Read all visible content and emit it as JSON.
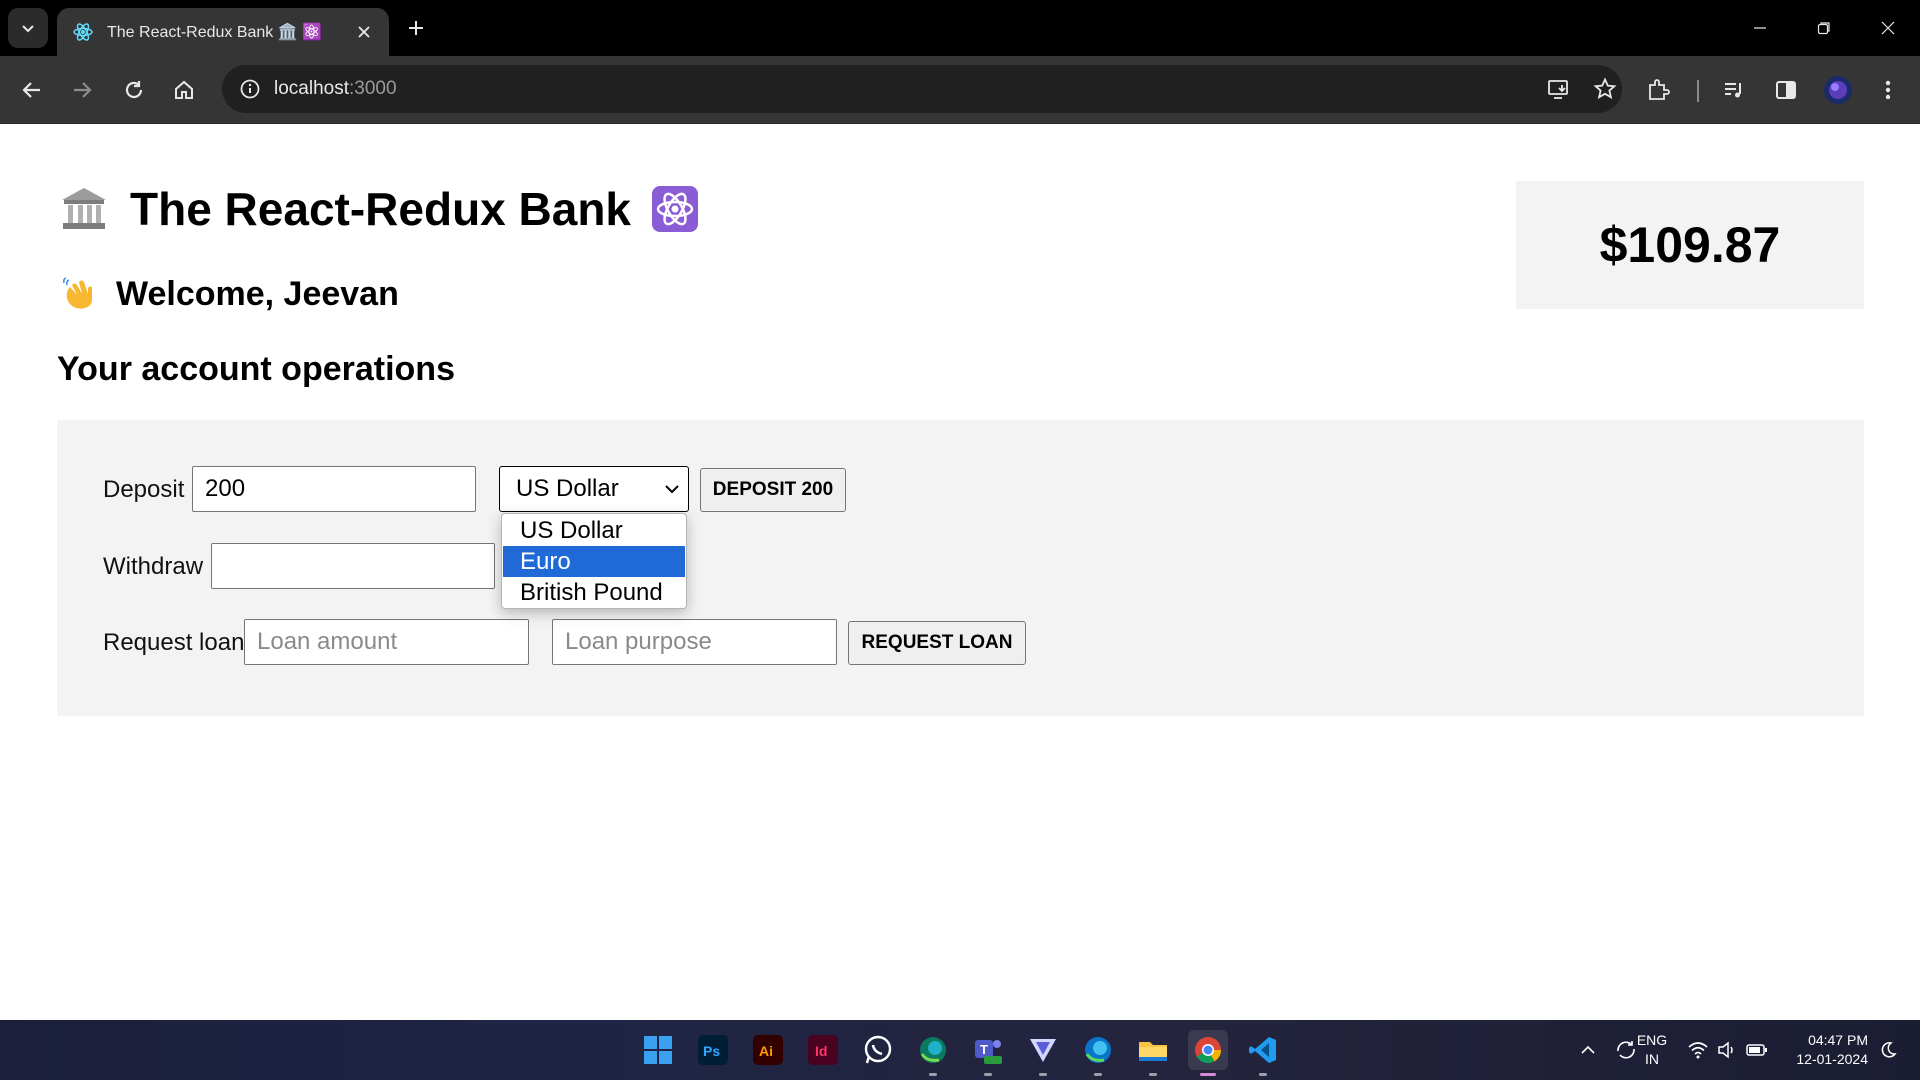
{
  "browser": {
    "tab_title": "The React-Redux Bank 🏛️ ⚛️",
    "url_host": "localhost",
    "url_port": ":3000"
  },
  "page": {
    "title": "The React-Redux Bank",
    "welcome": "Welcome, Jeevan",
    "operations_heading": "Your account operations",
    "balance": "$109.87"
  },
  "deposit": {
    "label": "Deposit",
    "amount": "200",
    "currency_selected": "US Dollar",
    "button": "DEPOSIT 200",
    "currency_options": [
      "US Dollar",
      "Euro",
      "British Pound"
    ],
    "highlighted_option": "Euro"
  },
  "withdraw": {
    "label": "Withdraw",
    "amount": ""
  },
  "loan": {
    "label": "Request loan",
    "amount_placeholder": "Loan amount",
    "purpose_placeholder": "Loan purpose",
    "button": "REQUEST LOAN"
  },
  "taskbar": {
    "apps": [
      "windows-start",
      "photoshop",
      "illustrator",
      "indesign",
      "whatsapp",
      "edge-dev",
      "teams",
      "vivaldi",
      "edge",
      "file-explorer",
      "chrome",
      "vscode"
    ],
    "lang_top": "ENG",
    "lang_bottom": "IN",
    "time": "04:47 PM",
    "date": "12-01-2024"
  },
  "colors": {
    "accent_highlight": "#1f6ad6",
    "panel_bg": "#f3f3f3",
    "chrome_bg": "#353535"
  }
}
